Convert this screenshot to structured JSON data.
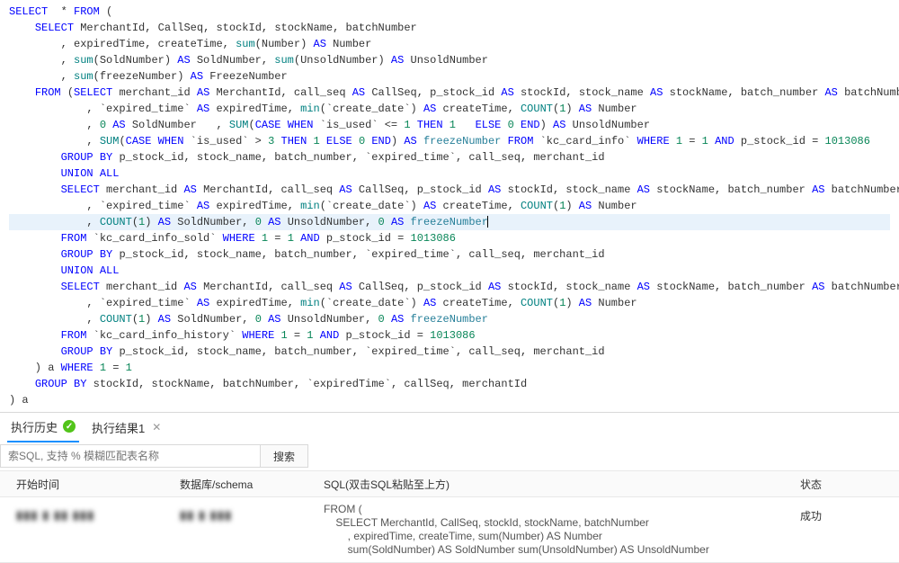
{
  "editor": {
    "lines": [
      {
        "indent": 0,
        "html": "<span class='kw'>SELECT</span>  <span class='op'>*</span> <span class='kw'>FROM</span> <span class='op'>(</span>"
      },
      {
        "indent": 1,
        "html": "<span class='kw'>SELECT</span> <span class='id'>MerchantId</span>, <span class='id'>CallSeq</span>, <span class='id'>stockId</span>, <span class='id'>stockName</span>, <span class='id'>batchNumber</span>"
      },
      {
        "indent": 2,
        "html": ", <span class='id'>expiredTime</span>, <span class='id'>createTime</span>, <span class='fn'>sum</span>(<span class='id'>Number</span>) <span class='kw'>AS</span> <span class='id'>Number</span>"
      },
      {
        "indent": 2,
        "html": ", <span class='fn'>sum</span>(<span class='id'>SoldNumber</span>) <span class='kw'>AS</span> <span class='id'>SoldNumber</span>, <span class='fn'>sum</span>(<span class='id'>UnsoldNumber</span>) <span class='kw'>AS</span> <span class='id'>UnsoldNumber</span>"
      },
      {
        "indent": 2,
        "html": ", <span class='fn'>sum</span>(<span class='id'>freezeNumber</span>) <span class='kw'>AS</span> <span class='id'>FreezeNumber</span>"
      },
      {
        "indent": 1,
        "html": "<span class='kw'>FROM</span> (<span class='kw'>SELECT</span> <span class='id'>merchant_id</span> <span class='kw'>AS</span> <span class='id'>MerchantId</span>, <span class='id'>call_seq</span> <span class='kw'>AS</span> <span class='id'>CallSeq</span>, <span class='id'>p_stock_id</span> <span class='kw'>AS</span> <span class='id'>stockId</span>, <span class='id'>stock_name</span> <span class='kw'>AS</span> <span class='id'>stockName</span>, <span class='id'>batch_number</span> <span class='kw'>AS</span> <span class='id'>batchNumber</span>"
      },
      {
        "indent": 3,
        "html": ", <span class='bq'>`expired_time`</span> <span class='kw'>AS</span> <span class='id'>expiredTime</span>, <span class='fn'>min</span>(<span class='bq'>`create_date`</span>) <span class='kw'>AS</span> <span class='id'>createTime</span>, <span class='fn'>COUNT</span>(<span class='num'>1</span>) <span class='kw'>AS</span> <span class='id'>Number</span>"
      },
      {
        "indent": 3,
        "html": ", <span class='num'>0</span> <span class='kw'>AS</span> <span class='id'>SoldNumber</span>   , <span class='fn'>SUM</span>(<span class='kw'>CASE</span> <span class='kw'>WHEN</span> <span class='bq'>`is_used`</span> &lt;= <span class='num'>1</span> <span class='kw'>THEN</span> <span class='num'>1</span>   <span class='kw'>ELSE</span> <span class='num'>0</span> <span class='kw'>END</span>) <span class='kw'>AS</span> <span class='id'>UnsoldNumber</span>"
      },
      {
        "indent": 3,
        "html": ", <span class='fn'>SUM</span>(<span class='kw'>CASE</span> <span class='kw'>WHEN</span> <span class='bq'>`is_used`</span> &gt; <span class='num'>3</span> <span class='kw'>THEN</span> <span class='num'>1</span> <span class='kw'>ELSE</span> <span class='num'>0</span> <span class='kw'>END</span>) <span class='kw'>AS</span> <span class='teal'>freezeNumber</span> <span class='kw'>FROM</span> <span class='bq'>`kc_card_info`</span> <span class='kw'>WHERE</span> <span class='num'>1</span> = <span class='num'>1</span> <span class='kw'>AND</span> <span class='id'>p_stock_id</span> = <span class='num'>1013086</span>"
      },
      {
        "indent": 2,
        "html": "<span class='kw'>GROUP</span> <span class='kw'>BY</span> <span class='id'>p_stock_id</span>, <span class='id'>stock_name</span>, <span class='id'>batch_number</span>, <span class='bq'>`expired_time`</span>, <span class='id'>call_seq</span>, <span class='id'>merchant_id</span>"
      },
      {
        "indent": 2,
        "html": "<span class='kw'>UNION</span> <span class='kw'>ALL</span>"
      },
      {
        "indent": 2,
        "html": "<span class='kw'>SELECT</span> <span class='id'>merchant_id</span> <span class='kw'>AS</span> <span class='id'>MerchantId</span>, <span class='id'>call_seq</span> <span class='kw'>AS</span> <span class='id'>CallSeq</span>, <span class='id'>p_stock_id</span> <span class='kw'>AS</span> <span class='id'>stockId</span>, <span class='id'>stock_name</span> <span class='kw'>AS</span> <span class='id'>stockName</span>, <span class='id'>batch_number</span> <span class='kw'>AS</span> <span class='id'>batchNumber</span>"
      },
      {
        "indent": 3,
        "html": ", <span class='bq'>`expired_time`</span> <span class='kw'>AS</span> <span class='id'>expiredTime</span>, <span class='fn'>min</span>(<span class='bq'>`create_date`</span>) <span class='kw'>AS</span> <span class='id'>createTime</span>, <span class='fn'>COUNT</span>(<span class='num'>1</span>) <span class='kw'>AS</span> <span class='id'>Number</span>"
      },
      {
        "indent": 3,
        "hl": true,
        "html": ", <span class='fn'>COUNT</span>(<span class='num'>1</span>) <span class='kw'>AS</span> <span class='id'>SoldNumber</span>, <span class='num'>0</span> <span class='kw'>AS</span> <span class='id'>UnsoldNumber</span>, <span class='num'>0</span> <span class='kw'>AS</span> <span class='teal'>freezeNumber</span><span class='cursor'></span>"
      },
      {
        "indent": 2,
        "html": "<span class='kw'>FROM</span> <span class='bq'>`kc_card_info_sold`</span> <span class='kw'>WHERE</span> <span class='num'>1</span> = <span class='num'>1</span> <span class='kw'>AND</span> <span class='id'>p_stock_id</span> = <span class='num'>1013086</span>"
      },
      {
        "indent": 2,
        "html": "<span class='kw'>GROUP</span> <span class='kw'>BY</span> <span class='id'>p_stock_id</span>, <span class='id'>stock_name</span>, <span class='id'>batch_number</span>, <span class='bq'>`expired_time`</span>, <span class='id'>call_seq</span>, <span class='id'>merchant_id</span>"
      },
      {
        "indent": 2,
        "html": "<span class='kw'>UNION</span> <span class='kw'>ALL</span>"
      },
      {
        "indent": 2,
        "html": "<span class='kw'>SELECT</span> <span class='id'>merchant_id</span> <span class='kw'>AS</span> <span class='id'>MerchantId</span>, <span class='id'>call_seq</span> <span class='kw'>AS</span> <span class='id'>CallSeq</span>, <span class='id'>p_stock_id</span> <span class='kw'>AS</span> <span class='id'>stockId</span>, <span class='id'>stock_name</span> <span class='kw'>AS</span> <span class='id'>stockName</span>, <span class='id'>batch_number</span> <span class='kw'>AS</span> <span class='id'>batchNumber</span>"
      },
      {
        "indent": 3,
        "html": ", <span class='bq'>`expired_time`</span> <span class='kw'>AS</span> <span class='id'>expiredTime</span>, <span class='fn'>min</span>(<span class='bq'>`create_date`</span>) <span class='kw'>AS</span> <span class='id'>createTime</span>, <span class='fn'>COUNT</span>(<span class='num'>1</span>) <span class='kw'>AS</span> <span class='id'>Number</span>"
      },
      {
        "indent": 3,
        "html": ", <span class='fn'>COUNT</span>(<span class='num'>1</span>) <span class='kw'>AS</span> <span class='id'>SoldNumber</span>, <span class='num'>0</span> <span class='kw'>AS</span> <span class='id'>UnsoldNumber</span>, <span class='num'>0</span> <span class='kw'>AS</span> <span class='teal'>freezeNumber</span>"
      },
      {
        "indent": 2,
        "html": "<span class='kw'>FROM</span> <span class='bq'>`kc_card_info_history`</span> <span class='kw'>WHERE</span> <span class='num'>1</span> = <span class='num'>1</span> <span class='kw'>AND</span> <span class='id'>p_stock_id</span> = <span class='num'>1013086</span>"
      },
      {
        "indent": 2,
        "html": "<span class='kw'>GROUP</span> <span class='kw'>BY</span> <span class='id'>p_stock_id</span>, <span class='id'>stock_name</span>, <span class='id'>batch_number</span>, <span class='bq'>`expired_time`</span>, <span class='id'>call_seq</span>, <span class='id'>merchant_id</span>"
      },
      {
        "indent": 1,
        "html": ") <span class='id'>a</span> <span class='kw'>WHERE</span> <span class='num'>1</span> = <span class='num'>1</span>"
      },
      {
        "indent": 1,
        "html": "<span class='kw'>GROUP</span> <span class='kw'>BY</span> <span class='id'>stockId</span>, <span class='id'>stockName</span>, <span class='id'>batchNumber</span>, <span class='bq'>`expiredTime`</span>, <span class='id'>callSeq</span>, <span class='id'>merchantId</span>"
      },
      {
        "indent": 0,
        "html": ") <span class='id'>a</span>"
      }
    ]
  },
  "panel": {
    "tabs": {
      "history": "执行历史",
      "result": "执行结果1"
    },
    "search": {
      "placeholder": "索SQL, 支持 % 模糊匹配表名称",
      "button": "搜索"
    },
    "headers": {
      "start": "开始时间",
      "schema": "数据库/schema",
      "sql": "SQL(双击SQL粘贴至上方)",
      "status": "状态"
    },
    "row": {
      "start": "▮▮▮ ▮ ▮▮ ▮▮▮",
      "schema": "▮▮ ▮ ▮▮▮",
      "sql": "FROM (\n    SELECT MerchantId, CallSeq, stockId, stockName, batchNumber\n        , expiredTime, createTime, sum(Number) AS Number\n        sum(SoldNumber) AS SoldNumber sum(UnsoldNumber) AS UnsoldNumber",
      "status": "成功"
    }
  }
}
